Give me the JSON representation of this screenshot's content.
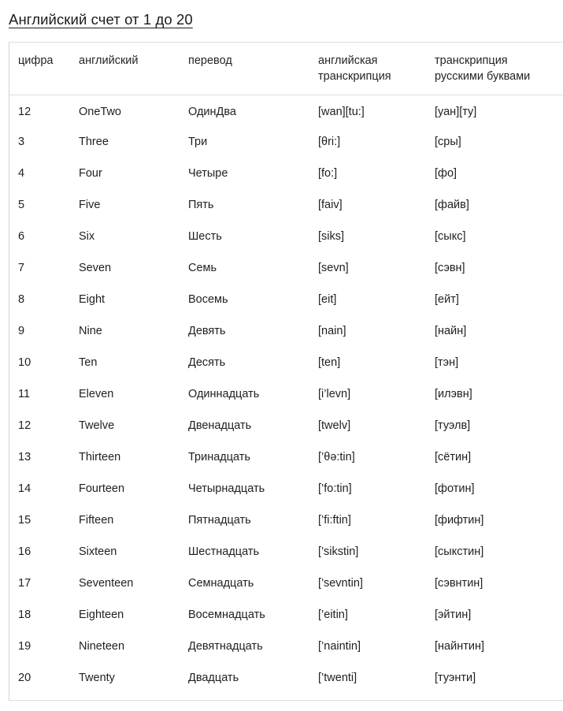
{
  "page": {
    "title": "Английский счет от 1 до 20"
  },
  "table": {
    "name": "english-numbers-table",
    "columns": [
      {
        "key": "digit",
        "label": "цифра"
      },
      {
        "key": "english",
        "label": "английский"
      },
      {
        "key": "translation",
        "label": "перевод"
      },
      {
        "key": "transcription_en",
        "label": "английская\nтранскрипция"
      },
      {
        "key": "transcription_ru",
        "label": "транскрипция\nрусскими буквами"
      }
    ],
    "rows": [
      {
        "digit": "12",
        "english": "OneTwo",
        "translation": "ОдинДва",
        "transcription_en": "[wan][tu:]",
        "transcription_ru": "[уан][ту]"
      },
      {
        "digit": "3",
        "english": "Three",
        "translation": "Три",
        "transcription_en": "[θri:]",
        "transcription_ru": "[сры]"
      },
      {
        "digit": "4",
        "english": "Four",
        "translation": "Четыре",
        "transcription_en": "[fo:]",
        "transcription_ru": "[фо]"
      },
      {
        "digit": "5",
        "english": "Five",
        "translation": "Пять",
        "transcription_en": "[faiv]",
        "transcription_ru": "[файв]"
      },
      {
        "digit": "6",
        "english": "Six",
        "translation": "Шесть",
        "transcription_en": "[siks]",
        "transcription_ru": "[сыкс]"
      },
      {
        "digit": "7",
        "english": "Seven",
        "translation": "Семь",
        "transcription_en": "[sevn]",
        "transcription_ru": "[сэвн]"
      },
      {
        "digit": "8",
        "english": "Eight",
        "translation": "Восемь",
        "transcription_en": "[eit]",
        "transcription_ru": "[ейт]"
      },
      {
        "digit": "9",
        "english": "Nine",
        "translation": "Девять",
        "transcription_en": "[nain]",
        "transcription_ru": "[найн]"
      },
      {
        "digit": "10",
        "english": "Ten",
        "translation": "Десять",
        "transcription_en": "[ten]",
        "transcription_ru": "[тэн]"
      },
      {
        "digit": "11",
        "english": "Eleven",
        "translation": "Одиннадцать",
        "transcription_en": "[i’levn]",
        "transcription_ru": "[илэвн]"
      },
      {
        "digit": "12",
        "english": "Twelve",
        "translation": "Двенадцать",
        "transcription_en": "[twelv]",
        "transcription_ru": "[туэлв]"
      },
      {
        "digit": "13",
        "english": "Thirteen",
        "translation": "Тринадцать",
        "transcription_en": "[’θə:tin]",
        "transcription_ru": "[сётин]"
      },
      {
        "digit": "14",
        "english": "Fourteen",
        "translation": "Четырнадцать",
        "transcription_en": "[’fo:tin]",
        "transcription_ru": "[фотин]"
      },
      {
        "digit": "15",
        "english": "Fifteen",
        "translation": "Пятнадцать",
        "transcription_en": "[’fi:ftin]",
        "transcription_ru": "[фифтин]"
      },
      {
        "digit": "16",
        "english": "Sixteen",
        "translation": "Шестнадцать",
        "transcription_en": "[’sikstin]",
        "transcription_ru": "[сыкстин]"
      },
      {
        "digit": "17",
        "english": "Seventeen",
        "translation": "Семнадцать",
        "transcription_en": "[’sevntin]",
        "transcription_ru": "[сэвнтин]"
      },
      {
        "digit": "18",
        "english": "Eighteen",
        "translation": "Восемнадцать",
        "transcription_en": "[’eitin]",
        "transcription_ru": "[эйтин]"
      },
      {
        "digit": "19",
        "english": "Nineteen",
        "translation": "Девятнадцать",
        "transcription_en": "[’naintin]",
        "transcription_ru": "[найнтин]"
      },
      {
        "digit": "20",
        "english": "Twenty",
        "translation": "Двадцать",
        "transcription_en": "[’twenti]",
        "transcription_ru": "[туэнти]"
      }
    ]
  },
  "colors": {
    "background": "#ffffff",
    "text": "#1f1f1f",
    "title_text": "#1b1b1b",
    "border": "#dddddd"
  }
}
